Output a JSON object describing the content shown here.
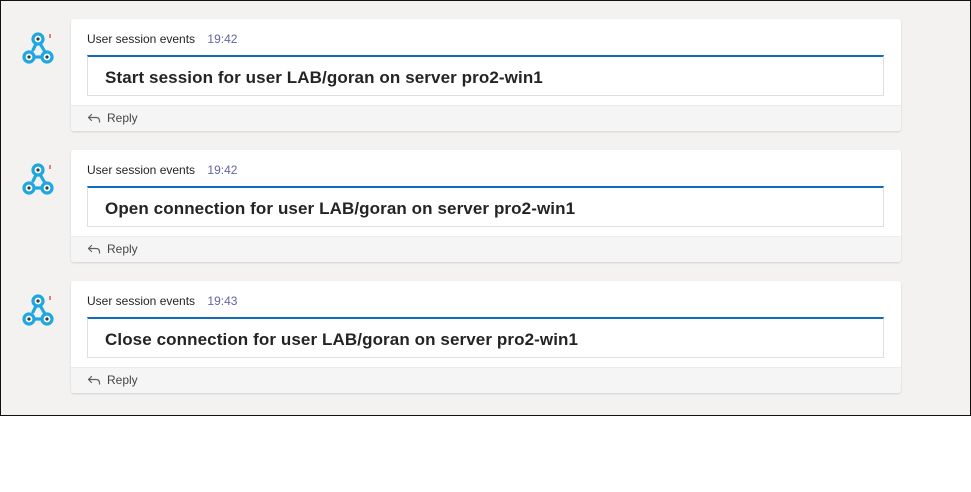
{
  "app": {
    "colors": {
      "background": "#f3f2f1",
      "card": "#ffffff",
      "accent_bar": "#0f6cbd",
      "timestamp": "#6264a7",
      "avatar_icon": "#1ea7e0"
    }
  },
  "events": [
    {
      "sender": "User session events",
      "time": "19:42",
      "text": "Start session for user LAB/goran on server pro2-win1",
      "reply_label": "Reply"
    },
    {
      "sender": "User session events",
      "time": "19:42",
      "text": "Open connection for user LAB/goran on server pro2-win1",
      "reply_label": "Reply"
    },
    {
      "sender": "User session events",
      "time": "19:43",
      "text": "Close connection for user LAB/goran on server pro2-win1",
      "reply_label": "Reply"
    }
  ]
}
